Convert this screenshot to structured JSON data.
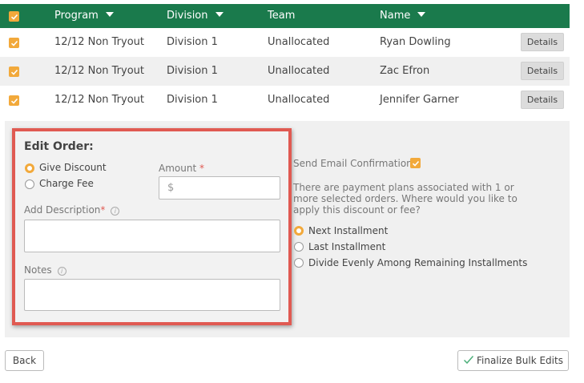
{
  "table": {
    "headers": {
      "program": "Program",
      "division": "Division",
      "team": "Team",
      "name": "Name"
    },
    "rows": [
      {
        "program": "12/12 Non Tryout",
        "division": "Division 1",
        "team": "Unallocated",
        "name": "Ryan Dowling",
        "action": "Details"
      },
      {
        "program": "12/12 Non Tryout",
        "division": "Division 1",
        "team": "Unallocated",
        "name": "Zac Efron",
        "action": "Details"
      },
      {
        "program": "12/12 Non Tryout",
        "division": "Division 1",
        "team": "Unallocated",
        "name": "Jennifer Garner",
        "action": "Details"
      }
    ]
  },
  "edit_order": {
    "title": "Edit Order:",
    "options": [
      {
        "label": "Give Discount",
        "selected": true
      },
      {
        "label": "Charge Fee",
        "selected": false
      }
    ],
    "amount_label": "Amount",
    "amount_required": "*",
    "amount_placeholder": "$",
    "description_label": "Add Description",
    "description_required": "*",
    "notes_label": "Notes",
    "info_glyph": "i"
  },
  "email": {
    "label": "Send Email Confirmation",
    "checked": true
  },
  "installments": {
    "message": "There are payment plans associated with 1 or more selected orders. Where would you like to apply this discount or fee?",
    "options": [
      {
        "label": "Next Installment",
        "selected": true
      },
      {
        "label": "Last Installment",
        "selected": false
      },
      {
        "label": "Divide Evenly Among Remaining Installments",
        "selected": false
      }
    ]
  },
  "footer": {
    "back_label": "Back",
    "finalize_label": "Finalize Bulk Edits"
  },
  "colors": {
    "header_green": "#1a7a4c",
    "accent_orange": "#f2a93b",
    "highlight_red": "#e05a52"
  }
}
